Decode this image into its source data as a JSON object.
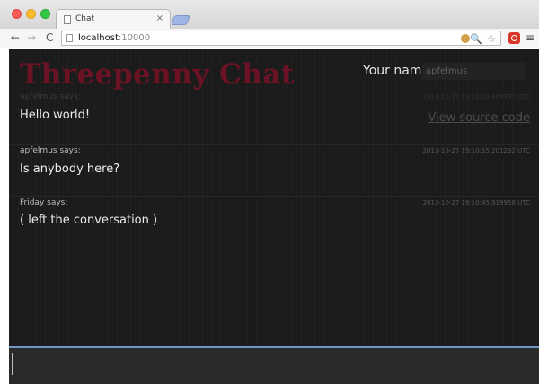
{
  "browser": {
    "tab_title": "Chat",
    "tab_close": "×",
    "url_host": "localhost",
    "url_port": ":10000",
    "back": "←",
    "forward": "→",
    "reload": "C",
    "zoom": "🔍",
    "star": "☆",
    "menu": "≡"
  },
  "app": {
    "title": "Threepenny Chat",
    "name_label": "Your name",
    "name_value": "apfelmus",
    "source_link": "View source code"
  },
  "messages": [
    {
      "sender": "apfelmus says:",
      "time": "2013-10-27 19:10:03.469797 UTC",
      "body": "Hello world!"
    },
    {
      "sender": "apfelmus says:",
      "time": "2013-10-27 19:10:15.201232 UTC",
      "body": "Is anybody here?"
    },
    {
      "sender": "Friday says:",
      "time": "2013-10-27 19:10:45.919958 UTC",
      "body": "( left the conversation )"
    }
  ],
  "colors": {
    "page_bg": "#1b1b1b",
    "title": "#6b1224",
    "compose_border": "#6f95c6"
  }
}
